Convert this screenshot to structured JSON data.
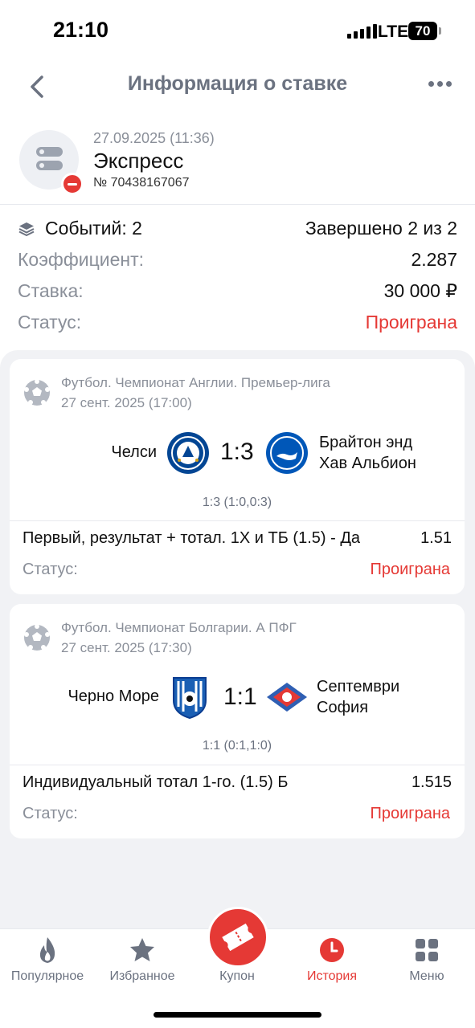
{
  "status_bar": {
    "time": "21:10",
    "network": "LTE",
    "battery": "70"
  },
  "nav": {
    "title": "Информация о ставке"
  },
  "bet": {
    "date": "27.09.2025 (11:36)",
    "type": "Экспресс",
    "number": "№ 70438167067"
  },
  "summary": {
    "events_label": "Событий: 2",
    "completed": "Завершено 2 из 2",
    "coef_label": "Коэффициент:",
    "coef_value": "2.287",
    "stake_label": "Ставка:",
    "stake_value": "30 000 ₽",
    "status_label": "Статус:",
    "status_value": "Проиграна"
  },
  "events": [
    {
      "league": "Футбол. Чемпионат Англии. Премьер-лига",
      "date": "27 сент. 2025 (17:00)",
      "home": "Челси",
      "away_line1": "Брайтон энд",
      "away_line2": "Хав Альбион",
      "score": "1:3",
      "score_detail": "1:3 (1:0,0:3)",
      "market": "Первый, результат + тотал. 1Х и ТБ (1.5) - Да",
      "odds": "1.51",
      "status_label": "Статус:",
      "status_value": "Проиграна"
    },
    {
      "league": "Футбол. Чемпионат Болгарии. А ПФГ",
      "date": "27 сент. 2025 (17:30)",
      "home": "Черно Море",
      "away_line1": "Септември",
      "away_line2": "София",
      "score": "1:1",
      "score_detail": "1:1 (0:1,1:0)",
      "market": "Индивидуальный тотал 1-го. (1.5) Б",
      "odds": "1.515",
      "status_label": "Статус:",
      "status_value": "Проиграна"
    }
  ],
  "tabs": [
    {
      "label": "Популярное",
      "icon": "flame-icon"
    },
    {
      "label": "Избранное",
      "icon": "star-icon"
    },
    {
      "label": "Купон",
      "icon": "ticket-icon"
    },
    {
      "label": "История",
      "icon": "clock-icon",
      "active": true
    },
    {
      "label": "Меню",
      "icon": "grid-icon"
    }
  ],
  "colors": {
    "accent": "#e53935",
    "muted": "#8a8f99",
    "background": "#f1f2f5"
  }
}
